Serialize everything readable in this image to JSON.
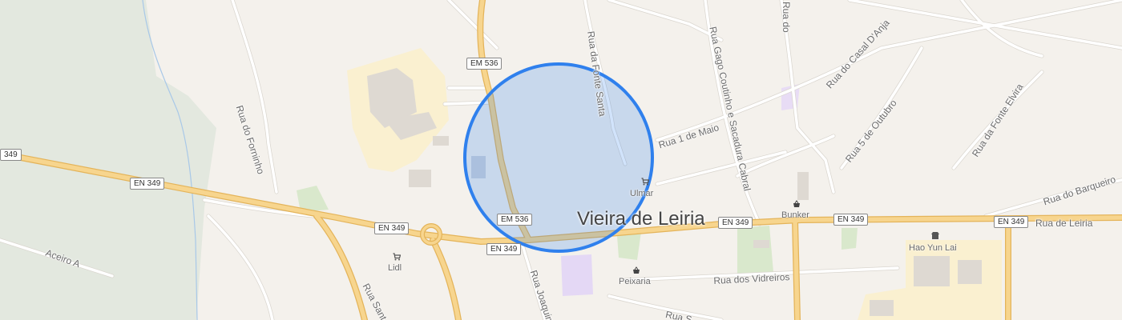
{
  "map": {
    "city": "Vieira de Leiria",
    "colors": {
      "land": "#f4f1ec",
      "forest": "#e3e8df",
      "road_major_fill": "#f7d58e",
      "road_major_edge": "#e4b45a",
      "road_minor": "#ffffff",
      "road_minor_edge": "#dad6cf",
      "accuracy": "#2f80ed"
    },
    "streets": [
      {
        "id": "rua-do-forninho",
        "name": "Rua do Forninho"
      },
      {
        "id": "aceiro-a",
        "name": "Aceiro A"
      },
      {
        "id": "rua-da-fonte-santa",
        "name": "Rua da Fonte Santa"
      },
      {
        "id": "rua-gago-coutinho",
        "name": "Rua Gago Coutinho e Sacadura Cabral"
      },
      {
        "id": "rua-do-casal-danja",
        "name": "Rua do Casal D'Anja"
      },
      {
        "id": "rua-1-de-maio",
        "name": "Rua 1 de Maio"
      },
      {
        "id": "rua-5-de-outubro",
        "name": "Rua 5 de Outubro"
      },
      {
        "id": "rua-da-fonte-elvira",
        "name": "Rua da Fonte Elvira"
      },
      {
        "id": "rua-do-barqueiro",
        "name": "Rua do Barqueiro"
      },
      {
        "id": "rua-de-leiria",
        "name": "Rua de Leiria"
      },
      {
        "id": "rua-dos-vidreiros",
        "name": "Rua dos Vidreiros"
      },
      {
        "id": "rua-joaquim",
        "name": "Rua Joaquim"
      },
      {
        "id": "rua-sant",
        "name": "Rua Sant"
      },
      {
        "id": "rua-s",
        "name": "Rua S"
      },
      {
        "id": "rua-top",
        "name": "Rua do"
      }
    ],
    "shields": {
      "em536_top": "EM 536",
      "em536_bottom": "EM 536",
      "en349_edge": "349",
      "en349_a": "EN 349",
      "en349_b": "EN 349",
      "en349_c": "EN 349",
      "en349_d": "EN 349",
      "en349_e": "EN 349",
      "en349_f": "EN 349"
    },
    "pois": [
      {
        "id": "ulmar",
        "name": "Ulmar",
        "icon": "shopping-cart-icon"
      },
      {
        "id": "bunker",
        "name": "Bunker",
        "icon": "shopping-basket-icon"
      },
      {
        "id": "lidl",
        "name": "Lidl",
        "icon": "shopping-cart-icon"
      },
      {
        "id": "peixaria",
        "name": "Peixaria",
        "icon": "shopping-basket-icon"
      },
      {
        "id": "hao-yun-lai",
        "name": "Hao Yun Lai",
        "icon": "shop-icon"
      }
    ]
  }
}
